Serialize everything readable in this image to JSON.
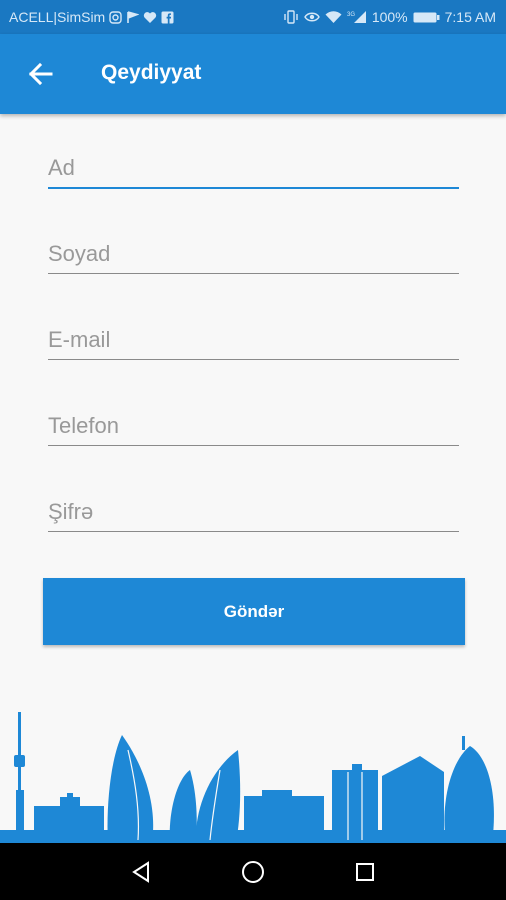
{
  "status_bar": {
    "carrier": "ACELL|SimSim",
    "battery": "100%",
    "time": "7:15 AM",
    "network": "3G",
    "icons": [
      "instagram-icon",
      "flag-icon",
      "heart-icon",
      "facebook-icon",
      "vibrate-icon",
      "eye-icon",
      "wifi-icon",
      "signal-icon",
      "battery-icon"
    ]
  },
  "app_bar": {
    "title": "Qeydiyyat",
    "back_icon": "arrow-left-icon"
  },
  "form": {
    "name_placeholder": "Ad",
    "surname_placeholder": "Soyad",
    "email_placeholder": "E-mail",
    "phone_placeholder": "Telefon",
    "password_placeholder": "Şifrə",
    "submit_label": "Göndər"
  },
  "nav_bar": {
    "icons": [
      "back-triangle-icon",
      "home-circle-icon",
      "recents-square-icon"
    ]
  },
  "colors": {
    "primary": "#1e88d6",
    "status_bar": "#1a78c2",
    "background": "#f8f8f8",
    "skyline": "#1e88d6"
  }
}
